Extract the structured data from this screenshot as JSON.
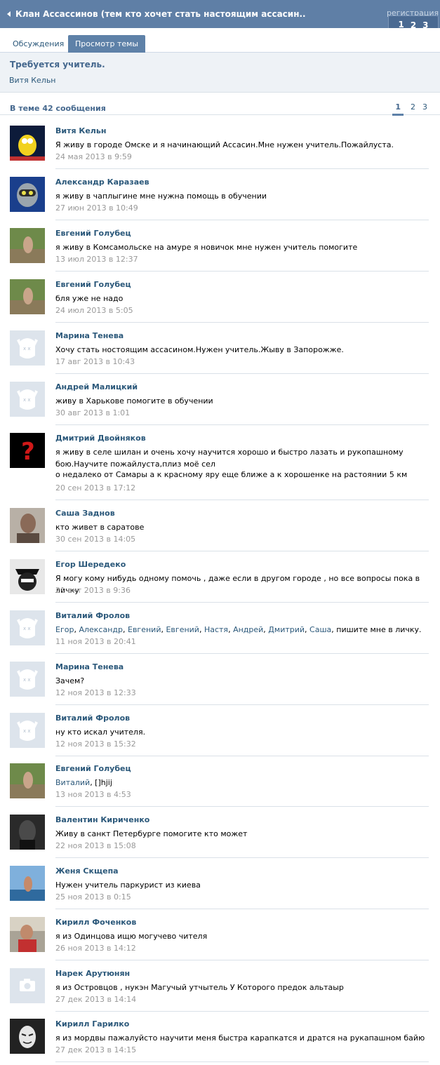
{
  "header": {
    "title": "Клан Ассассинов (тем кто хочет стать настоящим ассасин..",
    "register": "регистрация",
    "pages": [
      "1",
      "2",
      "3"
    ]
  },
  "tabs": [
    {
      "label": "Обсуждения"
    },
    {
      "label": "Просмотр темы"
    }
  ],
  "topic": {
    "title": "Требуется учитель.",
    "author": "Витя Кельн"
  },
  "message_count": "В теме 42 сообщения",
  "pagination": [
    "1",
    "2",
    "3"
  ],
  "colors": {
    "header_bg": "#5f7fa6",
    "link": "#2b587a",
    "date": "#999999",
    "active_tab": "#5e81a8"
  },
  "posts": [
    {
      "author": "Витя Кельн",
      "text": "Я живу в городе Омске и я начинающий Ассасин.Мне нужен учитель.Пожайлуста.",
      "date": "24 мая 2013 в 9:59",
      "avatar": "photo-avatar"
    },
    {
      "author": "Александр Каразаев",
      "text": "я живу в чаплыгине мне нужна помощь в обучении",
      "date": "27 июн 2013 в 10:49",
      "avatar": "photo-avatar"
    },
    {
      "author": "Евгений Голубец",
      "text": "я живу в Комсамольске на амуре я новичок мне нужен учитель помогите",
      "date": "13 июл 2013 в 12:37",
      "avatar": "photo-avatar"
    },
    {
      "author": "Евгений Голубец",
      "text": "бля уже не надо",
      "date": "24 июл 2013 в 5:05",
      "avatar": "photo-avatar"
    },
    {
      "author": "Марина Тенева",
      "text": "Хочу стать ностоящим ассасином.Нужен учитель.Жыву в Запорожже.",
      "date": "17 авг 2013 в 10:43",
      "avatar": "default-dog-avatar"
    },
    {
      "author": "Андрей Малицкий",
      "text": "живу в Харькове помогите в обучении",
      "date": "30 авг 2013 в 1:01",
      "avatar": "default-dog-avatar"
    },
    {
      "author": "Дмитрий Двойняков",
      "text": "я живу в селе шилан и очень хочу научится хорошо и быстро лазать и рукопашному бою.Научите пожайлуста,плиз моё сел",
      "text2": "о недалеко от Самары а к красному яру еще ближе а к хорошенке на растоянии 5 км",
      "date": "20 сен 2013 в 17:12",
      "avatar": "question-avatar"
    },
    {
      "author": "Саша Заднов",
      "text": "кто живет в саратове",
      "date": "30 сен 2013 в 14:05",
      "avatar": "photo-avatar"
    },
    {
      "author": "Егор Шередеко",
      "text": "Я могу кому нибудь одному помочь , даже если в другом городе , но все вопросы пока в личку",
      "date": "21 окт 2013 в 9:36",
      "avatar": "photo-avatar"
    },
    {
      "author": "Виталий Фролов",
      "mentions": [
        "Егор",
        "Александр",
        "Евгений",
        "Евгений",
        "Настя",
        "Андрей",
        "Дмитрий",
        "Саша"
      ],
      "text": ", пишите мне в личку.",
      "date": "11 ноя 2013 в 20:41",
      "avatar": "default-dog-avatar"
    },
    {
      "author": "Марина Тенева",
      "text": "Зачем?",
      "date": "12 ноя 2013 в 12:33",
      "avatar": "default-dog-avatar"
    },
    {
      "author": "Виталий Фролов",
      "text": "ну кто искал учителя.",
      "date": "12 ноя 2013 в 15:32",
      "avatar": "default-dog-avatar"
    },
    {
      "author": "Евгений Голубец",
      "mentions": [
        "Виталий"
      ],
      "text": ", []hjij",
      "date": "13 ноя 2013 в 4:53",
      "avatar": "photo-avatar"
    },
    {
      "author": "Валентин Кириченко",
      "text": "Живу в санкт Петербурге помогите кто может",
      "date": "22 ноя 2013 в 15:08",
      "avatar": "photo-avatar"
    },
    {
      "author": "Женя Скщепа",
      "text": "Нужен учитель паркурист из киева",
      "date": "25 ноя 2013 в 0:15",
      "avatar": "photo-avatar"
    },
    {
      "author": "Кирилл Фоченков",
      "text": "я из Одинцова ищю могучево чителя",
      "date": "26 ноя 2013 в 14:12",
      "avatar": "photo-avatar"
    },
    {
      "author": "Нарек Арутюнян",
      "text": "я из Островцов , нукэн Магучый утчытель У Которого предок альтаыр",
      "date": "27 дек 2013 в 14:14",
      "avatar": "camera-avatar"
    },
    {
      "author": "Кирилл Гарилко",
      "text": "я из мордвы пажалуйсто научити меня быстра карапкатся и дратся на рукапашном байю",
      "date": "27 дек 2013 в 14:15",
      "avatar": "photo-avatar"
    }
  ]
}
